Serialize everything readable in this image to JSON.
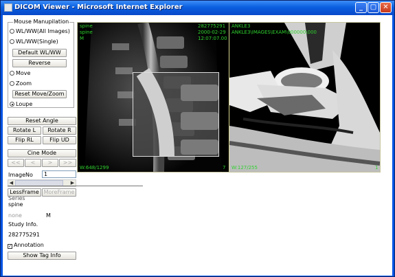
{
  "window": {
    "title": "DICOM Viewer - Microsoft Internet Explorer"
  },
  "mouse": {
    "legend": "Mouse Manupilation",
    "wl_all": "WL/WW(All Images)",
    "wl_single": "WL/WW(Single)",
    "default_wl": "Default WL/WW",
    "reverse": "Reverse",
    "move": "Move",
    "zoom": "Zoom",
    "reset_move_zoom": "Reset Move/Zoom",
    "loupe": "Loupe",
    "selected": "Loupe"
  },
  "controls": {
    "reset_angle": "Reset Angle",
    "rotate_l": "Rotate L",
    "rotate_r": "Rotate R",
    "flip_rl": "Flip RL",
    "flip_ud": "Flip UD",
    "cine_mode": "Cine Mode",
    "cine_first": "<<",
    "cine_prev": "<",
    "cine_next": ">",
    "cine_last": ">>"
  },
  "image": {
    "label": "ImageNo",
    "value": "1",
    "less_frame": "LessFrame",
    "more_frame": "MoreFrame"
  },
  "info": {
    "series_label": "Series",
    "series_value": "spine",
    "sex_label": "none",
    "sex_value": "M",
    "study_label": "Study Info.",
    "study_value": "282775291",
    "annotation": "Annotation",
    "annotation_checked": true,
    "show_tag": "Show Tag Info"
  },
  "viewer": {
    "left": {
      "tl1": "spine",
      "tl2": "spine",
      "tl3": "M",
      "tr1": "282775291",
      "tr2": "2000-02-29",
      "tr3": "12:07:07.00",
      "bl": "W:648/1299",
      "br": "7"
    },
    "right": {
      "tl1": "ANKLE3",
      "tl2": "ANKLE3\\IMAGES\\EXAM\\000000\\000",
      "bl": "W:127/255",
      "br": "1"
    },
    "overlay_color": "#2fd22f"
  }
}
